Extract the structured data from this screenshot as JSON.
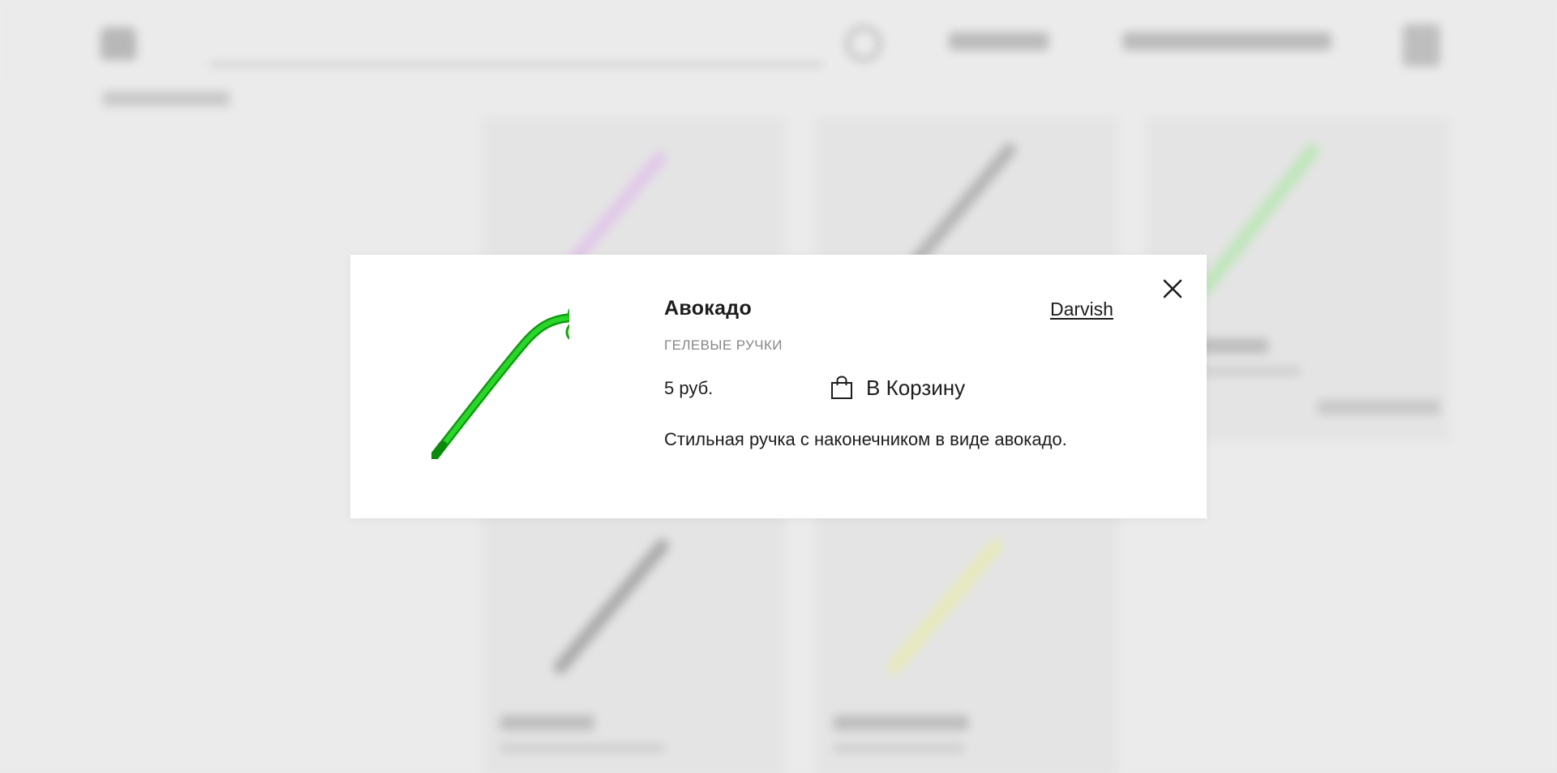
{
  "modal": {
    "title": "Авокадо",
    "brand": "Darvish",
    "category": "ГЕЛЕВЫЕ РУЧКИ",
    "price": "5 руб.",
    "add_to_cart_label": "В Корзину",
    "description": "Стильная ручка с наконечником в виде авокадо.",
    "close_icon": "close-icon",
    "cart_icon": "shopping-bag-icon",
    "product_image": "avocado-pen-image"
  },
  "colors": {
    "pen_green": "#1ec41e",
    "pen_dark_green": "#109a10",
    "avocado_pit": "#5a2a10",
    "text": "#1d1d1d",
    "muted": "#868686",
    "overlay": "#e9e9e9"
  }
}
